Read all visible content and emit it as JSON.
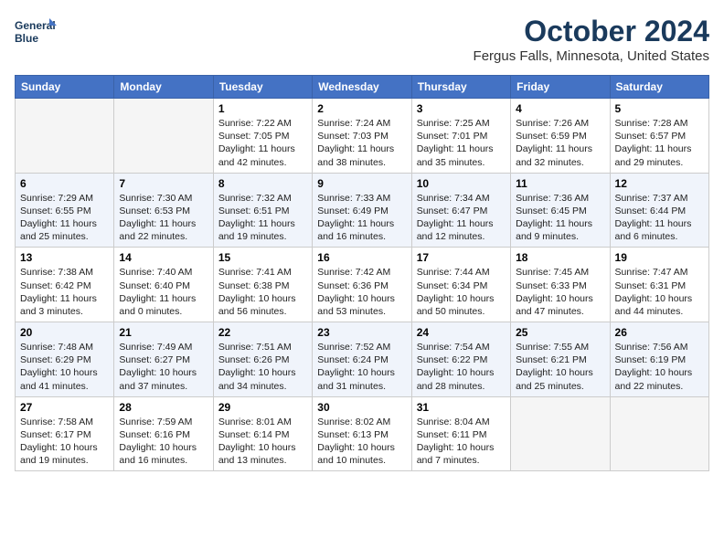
{
  "header": {
    "logo_line1": "General",
    "logo_line2": "Blue",
    "month": "October 2024",
    "location": "Fergus Falls, Minnesota, United States"
  },
  "weekdays": [
    "Sunday",
    "Monday",
    "Tuesday",
    "Wednesday",
    "Thursday",
    "Friday",
    "Saturday"
  ],
  "weeks": [
    [
      {
        "day": "",
        "info": ""
      },
      {
        "day": "",
        "info": ""
      },
      {
        "day": "1",
        "info": "Sunrise: 7:22 AM\nSunset: 7:05 PM\nDaylight: 11 hours and 42 minutes."
      },
      {
        "day": "2",
        "info": "Sunrise: 7:24 AM\nSunset: 7:03 PM\nDaylight: 11 hours and 38 minutes."
      },
      {
        "day": "3",
        "info": "Sunrise: 7:25 AM\nSunset: 7:01 PM\nDaylight: 11 hours and 35 minutes."
      },
      {
        "day": "4",
        "info": "Sunrise: 7:26 AM\nSunset: 6:59 PM\nDaylight: 11 hours and 32 minutes."
      },
      {
        "day": "5",
        "info": "Sunrise: 7:28 AM\nSunset: 6:57 PM\nDaylight: 11 hours and 29 minutes."
      }
    ],
    [
      {
        "day": "6",
        "info": "Sunrise: 7:29 AM\nSunset: 6:55 PM\nDaylight: 11 hours and 25 minutes."
      },
      {
        "day": "7",
        "info": "Sunrise: 7:30 AM\nSunset: 6:53 PM\nDaylight: 11 hours and 22 minutes."
      },
      {
        "day": "8",
        "info": "Sunrise: 7:32 AM\nSunset: 6:51 PM\nDaylight: 11 hours and 19 minutes."
      },
      {
        "day": "9",
        "info": "Sunrise: 7:33 AM\nSunset: 6:49 PM\nDaylight: 11 hours and 16 minutes."
      },
      {
        "day": "10",
        "info": "Sunrise: 7:34 AM\nSunset: 6:47 PM\nDaylight: 11 hours and 12 minutes."
      },
      {
        "day": "11",
        "info": "Sunrise: 7:36 AM\nSunset: 6:45 PM\nDaylight: 11 hours and 9 minutes."
      },
      {
        "day": "12",
        "info": "Sunrise: 7:37 AM\nSunset: 6:44 PM\nDaylight: 11 hours and 6 minutes."
      }
    ],
    [
      {
        "day": "13",
        "info": "Sunrise: 7:38 AM\nSunset: 6:42 PM\nDaylight: 11 hours and 3 minutes."
      },
      {
        "day": "14",
        "info": "Sunrise: 7:40 AM\nSunset: 6:40 PM\nDaylight: 11 hours and 0 minutes."
      },
      {
        "day": "15",
        "info": "Sunrise: 7:41 AM\nSunset: 6:38 PM\nDaylight: 10 hours and 56 minutes."
      },
      {
        "day": "16",
        "info": "Sunrise: 7:42 AM\nSunset: 6:36 PM\nDaylight: 10 hours and 53 minutes."
      },
      {
        "day": "17",
        "info": "Sunrise: 7:44 AM\nSunset: 6:34 PM\nDaylight: 10 hours and 50 minutes."
      },
      {
        "day": "18",
        "info": "Sunrise: 7:45 AM\nSunset: 6:33 PM\nDaylight: 10 hours and 47 minutes."
      },
      {
        "day": "19",
        "info": "Sunrise: 7:47 AM\nSunset: 6:31 PM\nDaylight: 10 hours and 44 minutes."
      }
    ],
    [
      {
        "day": "20",
        "info": "Sunrise: 7:48 AM\nSunset: 6:29 PM\nDaylight: 10 hours and 41 minutes."
      },
      {
        "day": "21",
        "info": "Sunrise: 7:49 AM\nSunset: 6:27 PM\nDaylight: 10 hours and 37 minutes."
      },
      {
        "day": "22",
        "info": "Sunrise: 7:51 AM\nSunset: 6:26 PM\nDaylight: 10 hours and 34 minutes."
      },
      {
        "day": "23",
        "info": "Sunrise: 7:52 AM\nSunset: 6:24 PM\nDaylight: 10 hours and 31 minutes."
      },
      {
        "day": "24",
        "info": "Sunrise: 7:54 AM\nSunset: 6:22 PM\nDaylight: 10 hours and 28 minutes."
      },
      {
        "day": "25",
        "info": "Sunrise: 7:55 AM\nSunset: 6:21 PM\nDaylight: 10 hours and 25 minutes."
      },
      {
        "day": "26",
        "info": "Sunrise: 7:56 AM\nSunset: 6:19 PM\nDaylight: 10 hours and 22 minutes."
      }
    ],
    [
      {
        "day": "27",
        "info": "Sunrise: 7:58 AM\nSunset: 6:17 PM\nDaylight: 10 hours and 19 minutes."
      },
      {
        "day": "28",
        "info": "Sunrise: 7:59 AM\nSunset: 6:16 PM\nDaylight: 10 hours and 16 minutes."
      },
      {
        "day": "29",
        "info": "Sunrise: 8:01 AM\nSunset: 6:14 PM\nDaylight: 10 hours and 13 minutes."
      },
      {
        "day": "30",
        "info": "Sunrise: 8:02 AM\nSunset: 6:13 PM\nDaylight: 10 hours and 10 minutes."
      },
      {
        "day": "31",
        "info": "Sunrise: 8:04 AM\nSunset: 6:11 PM\nDaylight: 10 hours and 7 minutes."
      },
      {
        "day": "",
        "info": ""
      },
      {
        "day": "",
        "info": ""
      }
    ]
  ]
}
